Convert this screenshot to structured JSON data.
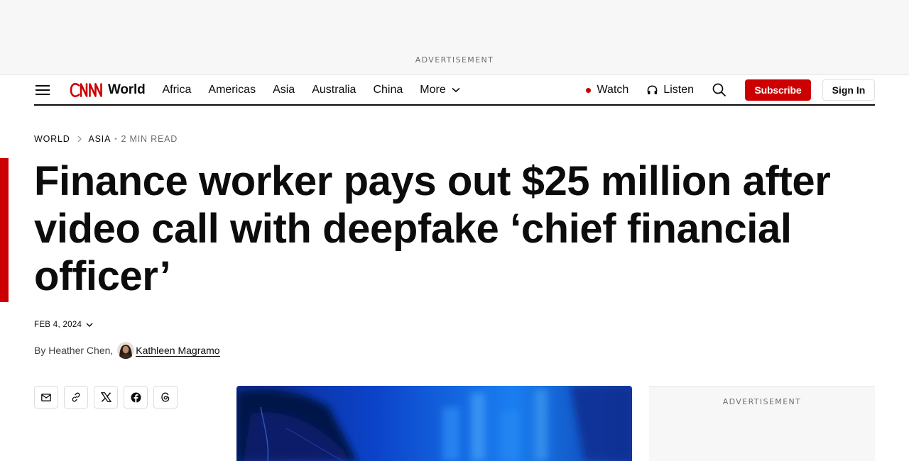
{
  "top_ad": {
    "label": "ADVERTISEMENT"
  },
  "nav": {
    "section": "World",
    "links": [
      "Africa",
      "Americas",
      "Asia",
      "Australia",
      "China"
    ],
    "more_label": "More",
    "watch_label": "Watch",
    "listen_label": "Listen",
    "subscribe_label": "Subscribe",
    "signin_label": "Sign In",
    "brand_color": "#cc0000"
  },
  "breadcrumb": {
    "section": "WORLD",
    "subsection": "ASIA",
    "separator": "•",
    "read_time": "2 MIN READ"
  },
  "article": {
    "headline": "Finance worker pays out $25 million after video call with deepfake ‘chief financial officer’",
    "date": "FEB 4, 2024",
    "byline_prefix": "By Heather Chen",
    "byline_comma": ",",
    "author2": "Kathleen Magramo"
  },
  "share": {
    "icons": [
      "email-icon",
      "link-icon",
      "x-icon",
      "facebook-icon",
      "threads-icon"
    ]
  },
  "side_ad": {
    "label": "ADVERTISEMENT"
  }
}
